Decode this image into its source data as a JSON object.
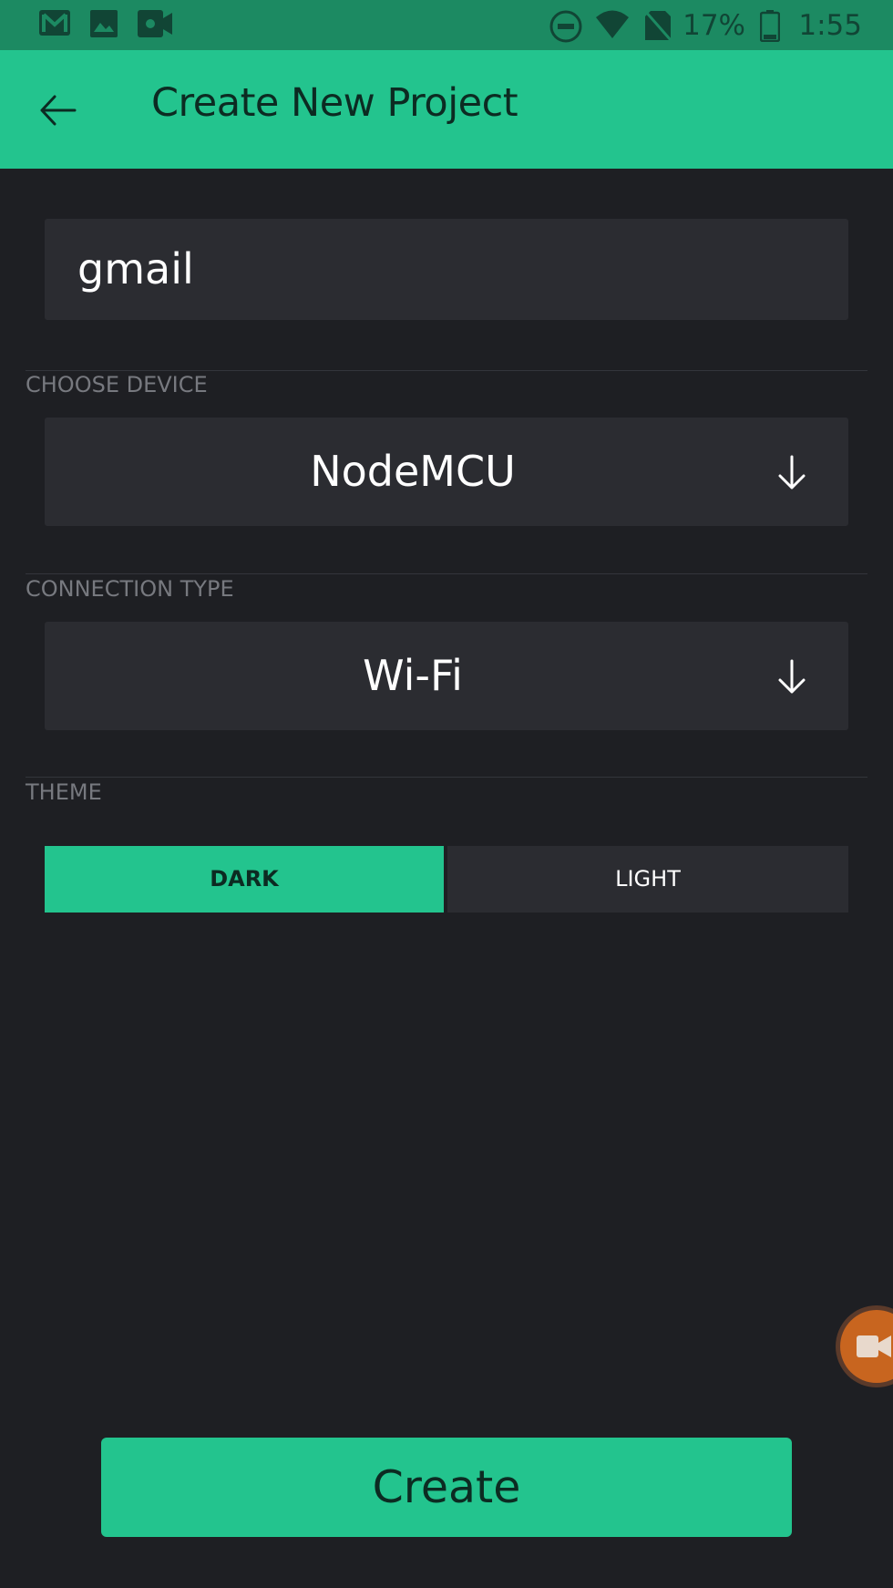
{
  "status_bar": {
    "icons": [
      "gmail-icon",
      "image-icon",
      "video-icon",
      "dnd-icon",
      "wifi-icon",
      "no-sim-icon",
      "battery-icon"
    ],
    "battery": "17%",
    "time": "1:55"
  },
  "app_bar": {
    "title": "Create New Project"
  },
  "form": {
    "project_name": "gmail",
    "choose_device_label": "CHOOSE DEVICE",
    "device_value": "NodeMCU",
    "connection_type_label": "CONNECTION TYPE",
    "connection_value": "Wi-Fi",
    "theme_label": "THEME",
    "theme_options": [
      "DARK",
      "LIGHT"
    ],
    "theme_selected": "DARK"
  },
  "create_button_label": "Create",
  "colors": {
    "accent": "#23c48e",
    "status_bar": "#1c8a62",
    "background": "#1e1f23",
    "field": "#2b2c31"
  }
}
